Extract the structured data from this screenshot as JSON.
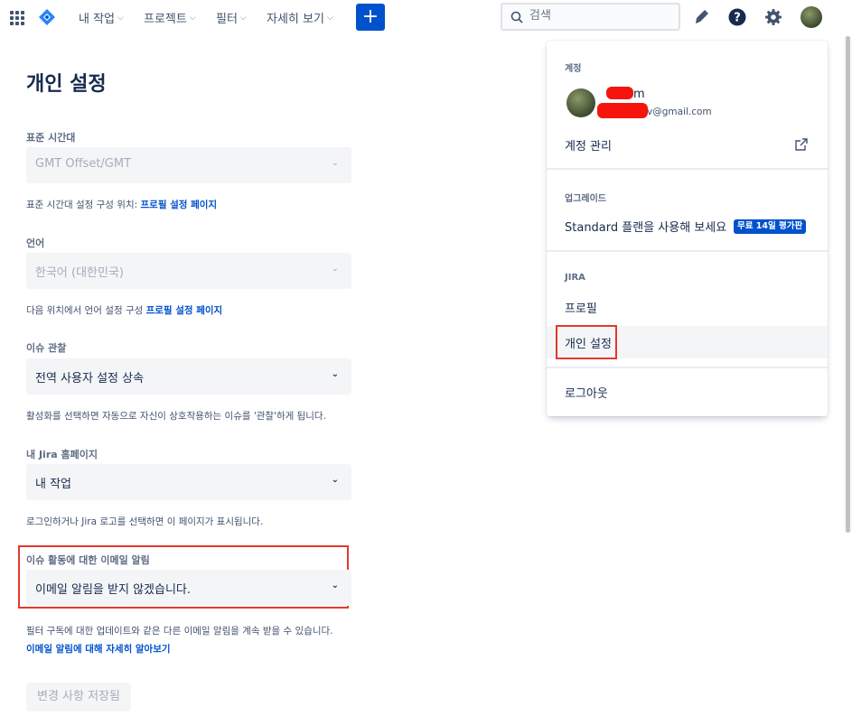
{
  "nav": {
    "items": [
      {
        "label": "내 작업"
      },
      {
        "label": "프로젝트"
      },
      {
        "label": "필터"
      },
      {
        "label": "자세히 보기"
      }
    ],
    "create_label": "+",
    "search_placeholder": "검색"
  },
  "page": {
    "title": "개인 설정",
    "timezone": {
      "label": "표준 시간대",
      "value": "GMT Offset/GMT",
      "help_prefix": "표준 시간대 설정 구성 위치: ",
      "help_link": "프로필 설정 페이지"
    },
    "language": {
      "label": "언어",
      "value": "한국어 (대한민국)",
      "help_prefix": "다음 위치에서 언어 설정 구성 ",
      "help_link": "프로필 설정 페이지"
    },
    "watch": {
      "label": "이슈 관찰",
      "value": "전역 사용자 설정 상속",
      "help": "활성화를 선택하면 자동으로 자신이 상호작용하는 이슈를 '관찰'하게 됩니다."
    },
    "homepage": {
      "label": "내 Jira 홈페이지",
      "value": "내 작업",
      "help": "로그인하거나 Jira 로고를 선택하면 이 페이지가 표시됩니다."
    },
    "email": {
      "label": "이슈 활동에 대한 이메일 알림",
      "value": "이메일 알림을 받지 않겠습니다.",
      "help": "필터 구독에 대한 업데이트와 같은 다른 이메일 알림을 계속 받을 수 있습니다.",
      "link": "이메일 알림에 대해 자세히 알아보기"
    },
    "save_label": "변경 사항 저장됨"
  },
  "menu": {
    "account_heading": "계정",
    "account_name_suffix": "m",
    "account_email_suffix": "v@gmail.com",
    "manage_account": "계정 관리",
    "upgrade_heading": "업그레이드",
    "upgrade_item": "Standard 플랜을 사용해 보세요",
    "trial_badge": "무료 14일 평가판",
    "jira_heading": "JIRA",
    "profile": "프로필",
    "personal_settings": "개인 설정",
    "logout": "로그아웃"
  },
  "colors": {
    "primary": "#0052cc",
    "highlight": "#e5382b",
    "text": "#172b4d"
  },
  "icons": [
    "app-switcher-icon",
    "jira-logo-icon",
    "search-icon",
    "notification-icon",
    "help-icon",
    "settings-icon",
    "external-link-icon"
  ]
}
